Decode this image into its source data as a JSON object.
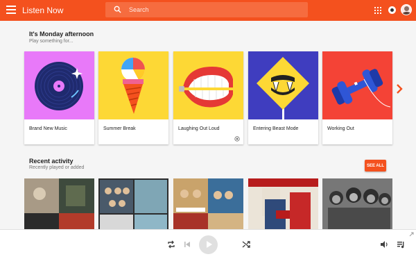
{
  "header": {
    "title": "Listen Now",
    "search_placeholder": "Search",
    "icons": [
      "menu-icon",
      "search-icon",
      "apps-icon",
      "cast-icon",
      "avatar"
    ]
  },
  "colors": {
    "accent": "#f4511e",
    "search_bg": "#f66c3f",
    "background": "#f5f5f5"
  },
  "greeting": {
    "title": "It's Monday afternoon",
    "subtitle": "Play something for..."
  },
  "cards": [
    {
      "label": "Brand New Music",
      "art": "vinyl-record",
      "bg": "#e879f9"
    },
    {
      "label": "Summer Break",
      "art": "ice-cream-beach-ball",
      "bg": "#fdd835"
    },
    {
      "label": "Laughing Out Loud",
      "art": "wind-up-teeth",
      "bg": "#fdd835",
      "badge": "radio-icon"
    },
    {
      "label": "Entering Beast Mode",
      "art": "fangs-sign",
      "bg": "#3f3dbf"
    },
    {
      "label": "Working Out",
      "art": "dumbbell",
      "bg": "#f44336"
    }
  ],
  "recent": {
    "title": "Recent activity",
    "subtitle": "Recently played or added",
    "see_all_label": "SEE ALL"
  },
  "player": {
    "icons": [
      "repeat-icon",
      "previous-icon",
      "play-icon",
      "shuffle-icon",
      "volume-icon",
      "queue-icon"
    ]
  }
}
